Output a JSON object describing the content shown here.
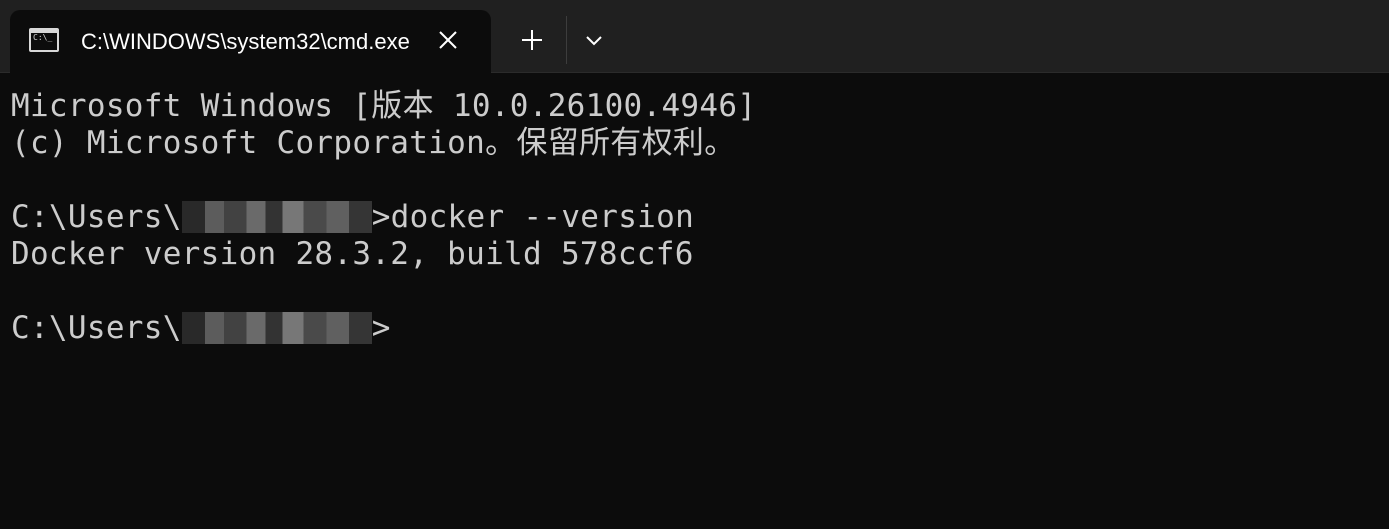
{
  "tab": {
    "icon": "command-prompt-icon",
    "icon_glyph": "C:\\_",
    "title": "C:\\WINDOWS\\system32\\cmd.exe",
    "close_icon": "close-icon"
  },
  "toolbar": {
    "new_tab_icon": "plus-icon",
    "dropdown_icon": "chevron-down-icon"
  },
  "terminal": {
    "line1": "Microsoft Windows [版本 10.0.26100.4946]",
    "line2": "(c) Microsoft Corporation。保留所有权利。",
    "prompt1_prefix": "C:\\Users\\",
    "prompt1_suffix": ">docker --version",
    "output1": "Docker version 28.3.2, build 578ccf6",
    "prompt2_prefix": "C:\\Users\\",
    "prompt2_suffix": ">"
  },
  "colors": {
    "background": "#0c0c0c",
    "titlebar": "#202020",
    "text": "#cccccc"
  }
}
